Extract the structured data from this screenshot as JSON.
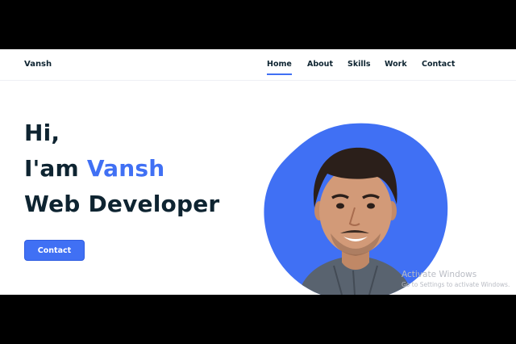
{
  "site": {
    "logo": "Vansh"
  },
  "nav": {
    "items": [
      {
        "label": "Home",
        "active": true
      },
      {
        "label": "About",
        "active": false
      },
      {
        "label": "Skills",
        "active": false
      },
      {
        "label": "Work",
        "active": false
      },
      {
        "label": "Contact",
        "active": false
      }
    ]
  },
  "hero": {
    "greeting": "Hi,",
    "intro_prefix": "I'am ",
    "name": "Vansh",
    "role": "Web Developer",
    "button_label": "Contact"
  },
  "watermark": {
    "title": "Activate Windows",
    "subtitle": "Go to Settings to activate Windows."
  },
  "colors": {
    "accent": "#4070f4",
    "text": "#0e2431",
    "background": "#ffffff"
  }
}
